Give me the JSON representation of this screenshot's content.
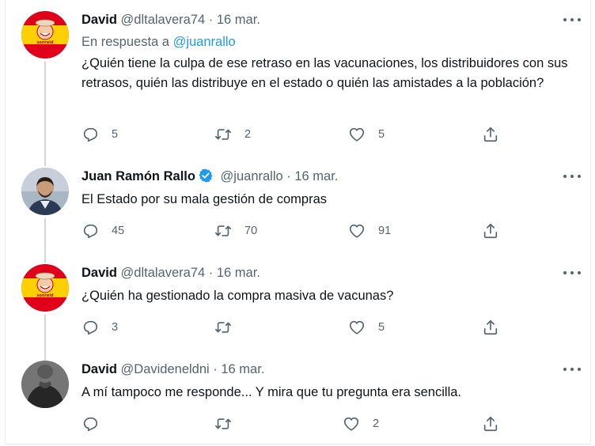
{
  "tweets": [
    {
      "name": "David",
      "handle": "@dltalavera74",
      "dot": "·",
      "date": "16 mar.",
      "reply_prefix": "En respuesta a",
      "reply_to": "@juanrallo",
      "text": "¿Quién tiene la culpa de ese retraso en las vacunaciones, los distribuidores con sus retrasos, quién las distribuye en el estado o quién las amistades a la población?",
      "avatar_text": "sonreid",
      "counts": {
        "reply": "5",
        "retweet": "2",
        "like": "5"
      }
    },
    {
      "name": "Juan Ramón Rallo",
      "handle": "@juanrallo",
      "dot": "·",
      "date": "16 mar.",
      "verified": true,
      "text": "El Estado por su mala gestión de compras",
      "counts": {
        "reply": "45",
        "retweet": "70",
        "like": "91"
      }
    },
    {
      "name": "David",
      "handle": "@dltalavera74",
      "dot": "·",
      "date": "16 mar.",
      "text": "¿Quién ha gestionado la compra masiva de vacunas?",
      "avatar_text": "sonreid",
      "counts": {
        "reply": "3",
        "retweet": "",
        "like": "5"
      }
    },
    {
      "name": "David",
      "handle": "@Davideneldni",
      "dot": "·",
      "date": "16 mar.",
      "text": "A mí tampoco me responde... Y mira que tu pregunta era sencilla.",
      "counts": {
        "reply": "",
        "retweet": "",
        "like": "2"
      }
    }
  ],
  "colors": {
    "accent": "#1d9bf0",
    "secondary_text": "#536471",
    "primary_text": "#0f1419",
    "thread_line": "#cfd9de"
  },
  "icons": [
    "more-icon",
    "reply-icon",
    "retweet-icon",
    "like-icon",
    "share-icon",
    "verified-badge-icon"
  ]
}
